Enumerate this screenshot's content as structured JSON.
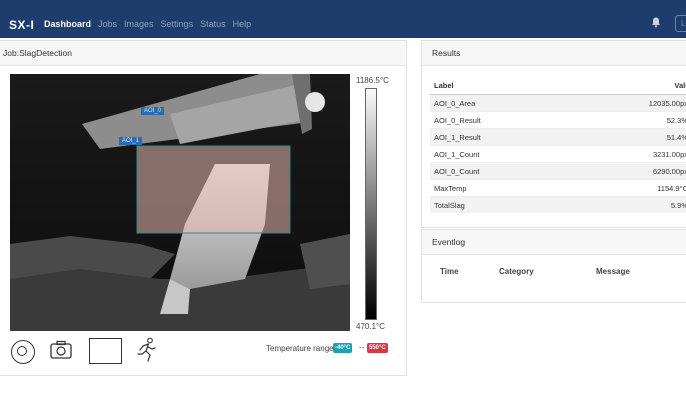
{
  "brand": "SX-I",
  "nav": {
    "items": [
      "Dashboard",
      "Jobs",
      "Images",
      "Settings",
      "Status",
      "Help"
    ],
    "active": "Dashboard",
    "login_label": "Logout"
  },
  "job": {
    "title": "Job:SlagDetection",
    "scale_max": "1186.5°C",
    "scale_min": "470.1°C",
    "aoi_labels": [
      "AOI_0",
      "AOI_1"
    ],
    "temperature_range_label": "Temperature range:",
    "temp_min_badge": "-40°C",
    "temp_max_badge": "550°C",
    "temp_separator": "--",
    "icons": [
      "pause-icon",
      "camera-icon",
      "rectangle-tool-icon",
      "running-person-icon"
    ]
  },
  "results": {
    "title": "Results",
    "columns": [
      "Label",
      "Value"
    ],
    "rows": [
      {
        "label": "AOI_0_Area",
        "value": "12035.00px"
      },
      {
        "label": "AOI_0_Result",
        "value": "52.3%"
      },
      {
        "label": "AOI_1_Result",
        "value": "51.4%"
      },
      {
        "label": "AOI_1_Count",
        "value": "3231.00px"
      },
      {
        "label": "AOI_0_Count",
        "value": "6290.00px"
      },
      {
        "label": "MaxTemp",
        "value": "1154.9°C"
      },
      {
        "label": "TotalSlag",
        "value": "5.9%"
      }
    ]
  },
  "eventlog": {
    "title": "Eventlog",
    "columns": [
      "Time",
      "Category",
      "Message"
    ]
  },
  "colors": {
    "navbar": "#1e3d6c",
    "badge_min": "#17a2b8",
    "badge_max": "#dc3545",
    "aoi_fill": "#e8b8ad"
  }
}
